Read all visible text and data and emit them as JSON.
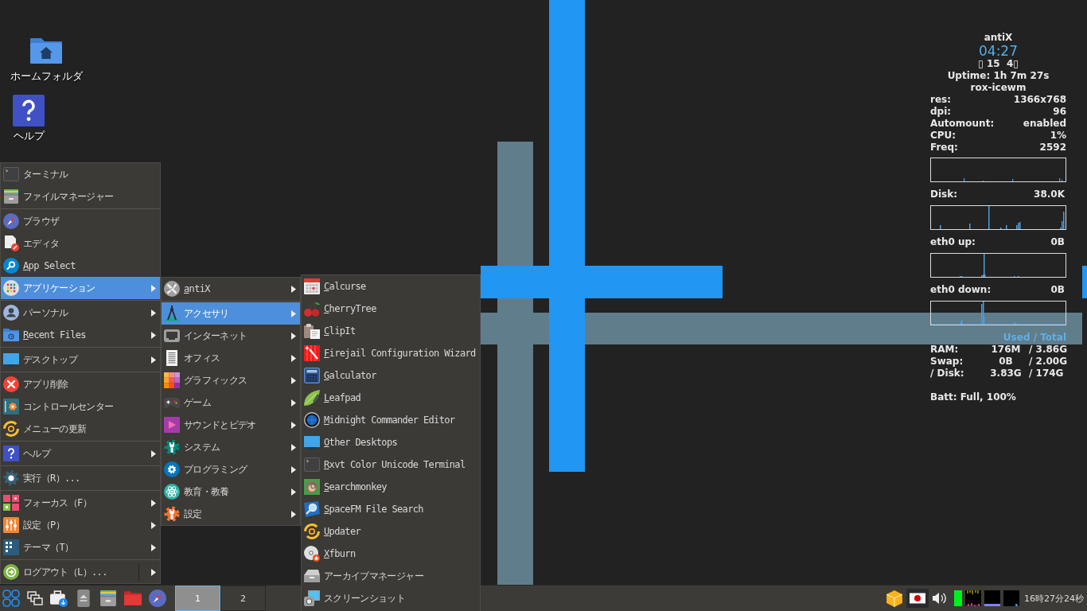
{
  "desktop_icons": [
    {
      "label": "ホームフォルダ"
    },
    {
      "label": "ヘルプ"
    }
  ],
  "start_menu": {
    "groups": [
      {
        "items": [
          {
            "label": "ターミナル",
            "kind": "entry",
            "selected": false,
            "has_submenu": false,
            "underline_first": false
          },
          {
            "label": "ファイルマネージャー",
            "kind": "entry",
            "selected": false,
            "has_submenu": false,
            "underline_first": false
          }
        ]
      },
      {
        "items": [
          {
            "label": "ブラウザ",
            "kind": "entry",
            "selected": false,
            "has_submenu": false,
            "underline_first": false
          },
          {
            "label": "エディタ",
            "kind": "entry",
            "selected": false,
            "has_submenu": false,
            "underline_first": false
          },
          {
            "label": "App Select",
            "kind": "entry",
            "selected": false,
            "has_submenu": false,
            "underline_first": true
          },
          {
            "label": "アプリケーション",
            "kind": "entry",
            "selected": true,
            "has_submenu": true,
            "underline_first": false
          }
        ]
      },
      {
        "items": [
          {
            "label": "パーソナル",
            "kind": "entry",
            "selected": false,
            "has_submenu": true,
            "underline_first": false
          },
          {
            "label": "Recent Files",
            "kind": "entry",
            "selected": false,
            "has_submenu": true,
            "underline_first": true
          }
        ]
      },
      {
        "items": [
          {
            "label": "デスクトップ",
            "kind": "entry",
            "selected": false,
            "has_submenu": true,
            "underline_first": false
          }
        ]
      },
      {
        "items": [
          {
            "label": "アプリ削除",
            "kind": "entry",
            "selected": false,
            "has_submenu": false,
            "underline_first": false
          },
          {
            "label": "コントロールセンター",
            "kind": "entry",
            "selected": false,
            "has_submenu": false,
            "underline_first": false
          },
          {
            "label": "メニューの更新",
            "kind": "entry",
            "selected": false,
            "has_submenu": false,
            "underline_first": false
          }
        ]
      },
      {
        "items": [
          {
            "label": "ヘルプ",
            "kind": "entry",
            "selected": false,
            "has_submenu": true,
            "underline_first": false
          }
        ]
      },
      {
        "items": [
          {
            "label": "実行（R）...",
            "kind": "entry",
            "selected": false,
            "has_submenu": false,
            "underline_first": false
          }
        ]
      },
      {
        "items": [
          {
            "label": "フォーカス（F）",
            "kind": "entry",
            "selected": false,
            "has_submenu": true,
            "underline_first": false
          },
          {
            "label": "設定（P）",
            "kind": "entry",
            "selected": false,
            "has_submenu": true,
            "underline_first": false
          },
          {
            "label": "テーマ（T）",
            "kind": "entry",
            "selected": false,
            "has_submenu": true,
            "underline_first": false
          }
        ]
      },
      {
        "items": [
          {
            "label": "ログアウト（L）...",
            "kind": "split",
            "selected": false,
            "has_submenu": true,
            "underline_first": false
          }
        ]
      }
    ]
  },
  "applications_menu": {
    "groups": [
      {
        "items": [
          {
            "label": "antiX",
            "selected": false,
            "has_submenu": true,
            "underline_first": true
          }
        ]
      },
      {
        "items": [
          {
            "label": "アクセサリ",
            "selected": true,
            "has_submenu": true,
            "underline_first": false
          },
          {
            "label": "インターネット",
            "selected": false,
            "has_submenu": true,
            "underline_first": false
          },
          {
            "label": "オフィス",
            "selected": false,
            "has_submenu": true,
            "underline_first": false
          },
          {
            "label": "グラフィックス",
            "selected": false,
            "has_submenu": true,
            "underline_first": false
          },
          {
            "label": "ゲーム",
            "selected": false,
            "has_submenu": true,
            "underline_first": false
          },
          {
            "label": "サウンドとビデオ",
            "selected": false,
            "has_submenu": true,
            "underline_first": false
          },
          {
            "label": "システム",
            "selected": false,
            "has_submenu": true,
            "underline_first": false
          },
          {
            "label": "プログラミング",
            "selected": false,
            "has_submenu": true,
            "underline_first": false
          },
          {
            "label": "教育・教養",
            "selected": false,
            "has_submenu": true,
            "underline_first": false
          },
          {
            "label": "設定",
            "selected": false,
            "has_submenu": true,
            "underline_first": false
          }
        ]
      }
    ]
  },
  "accessories_menu": {
    "items": [
      {
        "label": "Calcurse",
        "selected": false,
        "underline_first": true
      },
      {
        "label": "CherryTree",
        "selected": false,
        "underline_first": true
      },
      {
        "label": "ClipIt",
        "selected": false,
        "underline_first": true
      },
      {
        "label": "Firejail Configuration Wizard",
        "selected": false,
        "underline_first": true
      },
      {
        "label": "Galculator",
        "selected": false,
        "underline_first": true
      },
      {
        "label": "Leafpad",
        "selected": false,
        "underline_first": true
      },
      {
        "label": "Midnight Commander Editor",
        "selected": false,
        "underline_first": true
      },
      {
        "label": "Other Desktops",
        "selected": false,
        "underline_first": true
      },
      {
        "label": "Rxvt Color Unicode Terminal",
        "selected": false,
        "underline_first": true
      },
      {
        "label": "Searchmonkey",
        "selected": false,
        "underline_first": true
      },
      {
        "label": "SpaceFM File Search",
        "selected": false,
        "underline_first": true
      },
      {
        "label": "Updater",
        "selected": false,
        "underline_first": true
      },
      {
        "label": "Xfburn",
        "selected": false,
        "underline_first": true
      },
      {
        "label": "アーカイブマネージャー",
        "selected": false,
        "underline_first": false
      },
      {
        "label": "スクリーンショット",
        "selected": false,
        "underline_first": false
      }
    ]
  },
  "system_monitor": {
    "title": "antiX",
    "time": "04:27",
    "date": "▯ 15  4▯",
    "uptime": "Uptime: 1h 7m 27s",
    "session": "rox-icewm",
    "stats": [
      {
        "label": "res:",
        "value": "1366x768"
      },
      {
        "label": "dpi:",
        "value": "96"
      },
      {
        "label": "Automount:",
        "value": "enabled"
      },
      {
        "label": "CPU:",
        "value": "1%"
      },
      {
        "label": "Freq:",
        "value": "2592"
      }
    ],
    "monitors": [
      {
        "label": "Disk:",
        "value": "38.0K"
      },
      {
        "label": "eth0 up:",
        "value": "0B"
      },
      {
        "label": "eth0 down:",
        "value": "0B"
      }
    ],
    "usage_header": "Used / Total",
    "usage": [
      {
        "label": "RAM:",
        "used": "176M",
        "total": "/ 3.86G"
      },
      {
        "label": "Swap:",
        "used": "0B",
        "total": "/ 2.00G"
      },
      {
        "label": "/ Disk:",
        "used": "3.83G",
        "total": "/ 174G"
      }
    ],
    "battery": "Batt: Full, 100%"
  },
  "taskbar": {
    "workspaces": [
      {
        "label": "1",
        "selected": true
      },
      {
        "label": "2",
        "selected": false
      }
    ],
    "clock": "16時27分24秒"
  }
}
